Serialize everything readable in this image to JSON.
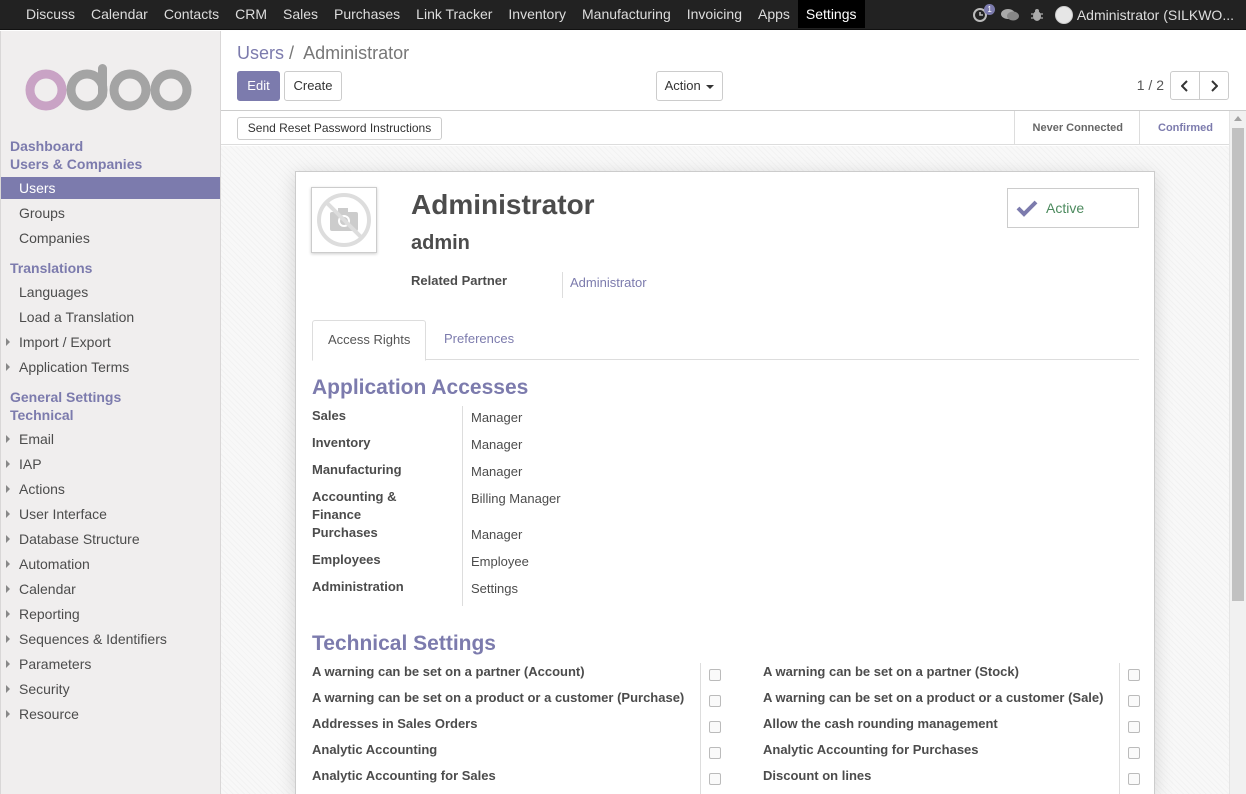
{
  "nav": {
    "menu": [
      "Discuss",
      "Calendar",
      "Contacts",
      "CRM",
      "Sales",
      "Purchases",
      "Link Tracker",
      "Inventory",
      "Manufacturing",
      "Invoicing",
      "Apps",
      "Settings"
    ],
    "active": "Settings",
    "notification_count": "1",
    "user_label": "Administrator (SILKWO..."
  },
  "sidebar": {
    "logo_text": "odoo",
    "sections": {
      "dashboard": "Dashboard",
      "users_companies": "Users & Companies",
      "translations": "Translations",
      "general_settings": "General Settings",
      "technical": "Technical"
    },
    "items": {
      "users": "Users",
      "groups": "Groups",
      "companies": "Companies",
      "languages": "Languages",
      "load_translation": "Load a Translation",
      "import_export": "Import / Export",
      "application_terms": "Application Terms",
      "email": "Email",
      "iap": "IAP",
      "actions": "Actions",
      "user_interface": "User Interface",
      "database_structure": "Database Structure",
      "automation": "Automation",
      "calendar": "Calendar",
      "reporting": "Reporting",
      "sequences": "Sequences & Identifiers",
      "parameters": "Parameters",
      "security": "Security",
      "resource": "Resource"
    }
  },
  "control_panel": {
    "breadcrumb_parent": "Users",
    "breadcrumb_sep": "/",
    "breadcrumb_current": "Administrator",
    "edit_label": "Edit",
    "create_label": "Create",
    "action_label": "Action",
    "pager": "1 / 2"
  },
  "header": {
    "reset_password_label": "Send Reset Password Instructions",
    "status_never": "Never Connected",
    "status_confirmed": "Confirmed"
  },
  "form": {
    "name": "Administrator",
    "login": "admin",
    "related_partner_label": "Related Partner",
    "related_partner_value": "Administrator",
    "active_label": "Active",
    "tabs": {
      "access_rights": "Access Rights",
      "preferences": "Preferences"
    },
    "app_access_title": "Application Accesses",
    "app_access": [
      {
        "label": "Sales",
        "value": "Manager"
      },
      {
        "label": "Inventory",
        "value": "Manager"
      },
      {
        "label": "Manufacturing",
        "value": "Manager"
      },
      {
        "label": "Accounting & Finance",
        "value": "Billing Manager"
      },
      {
        "label": "Purchases",
        "value": "Manager"
      },
      {
        "label": "Employees",
        "value": "Employee"
      },
      {
        "label": "Administration",
        "value": "Settings"
      }
    ],
    "tech_title": "Technical Settings",
    "tech_left": [
      "A warning can be set on a partner (Account)",
      "A warning can be set on a product or a customer (Purchase)",
      "Addresses in Sales Orders",
      "Analytic Accounting",
      "Analytic Accounting for Sales"
    ],
    "tech_right": [
      "A warning can be set on a partner (Stock)",
      "A warning can be set on a product or a customer (Sale)",
      "Allow the cash rounding management",
      "Analytic Accounting for Purchases",
      "Discount on lines"
    ]
  },
  "colors": {
    "brand": "#7c7bad",
    "navbar": "#222222",
    "active_check": "#7c7bad"
  }
}
